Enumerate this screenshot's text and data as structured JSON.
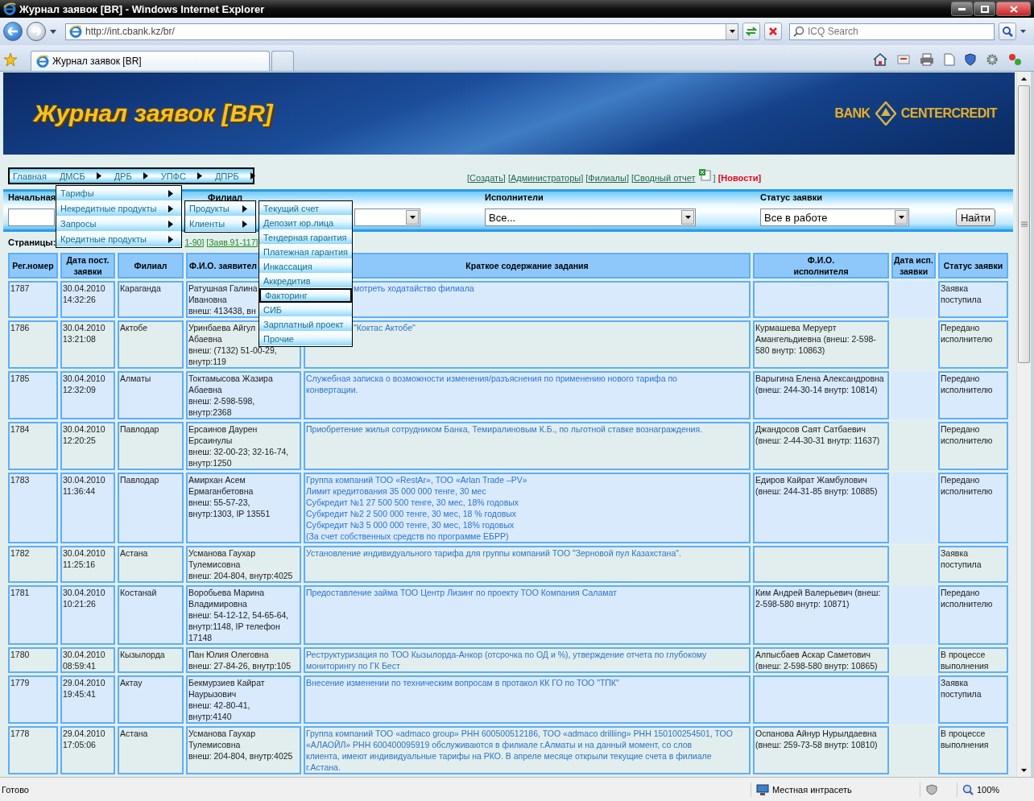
{
  "window": {
    "title": "Журнал заявок [BR] - Windows Internet Explorer"
  },
  "address_bar": {
    "url": "http://int.cbank.kz/br/"
  },
  "search": {
    "placeholder": "ICQ Search"
  },
  "tabs": [
    {
      "label": "Журнал заявок [BR]",
      "selected": true
    }
  ],
  "page": {
    "banner": {
      "title": "Журнал заявок [BR]",
      "logo_left": "BANK",
      "logo_right": "CENTERCREDIT"
    },
    "nav": [
      {
        "label": "Главная",
        "has_submenu": false
      },
      {
        "label": "ДМСБ",
        "has_submenu": true
      },
      {
        "label": "ДРБ",
        "has_submenu": true
      },
      {
        "label": "УПФС",
        "has_submenu": true
      },
      {
        "label": "ДПРБ",
        "has_submenu": true
      }
    ],
    "nav_menu": [
      {
        "label": "Тарифы",
        "has_submenu": true
      },
      {
        "label": "Некредитные продукты",
        "has_submenu": true
      },
      {
        "label": "Запросы",
        "has_submenu": true
      },
      {
        "label": "Кредитные продукты",
        "has_submenu": true
      }
    ],
    "submenu": [
      {
        "label": "Продукты",
        "has_submenu": true
      },
      {
        "label": "Клиенты",
        "has_submenu": true
      }
    ],
    "product_menu": [
      {
        "label": "Текущий счет",
        "selected": false
      },
      {
        "label": "Депозит юр.лица",
        "selected": false
      },
      {
        "label": "Тендерная гарантия",
        "selected": false
      },
      {
        "label": "Платежная гарантия",
        "selected": false
      },
      {
        "label": "Инкассация",
        "selected": false
      },
      {
        "label": "Аккредитив",
        "selected": false
      },
      {
        "label": "Факторинг",
        "selected": true
      },
      {
        "label": "СИБ",
        "selected": false
      },
      {
        "label": "Зарплатный проект",
        "selected": false
      },
      {
        "label": "Прочие",
        "selected": false
      }
    ],
    "links": [
      {
        "label": "[Создать]",
        "kind": "link"
      },
      {
        "label": "[Администраторы]",
        "kind": "link"
      },
      {
        "label": "[Филиалы]",
        "kind": "link"
      },
      {
        "label": "[Сводный отчет ",
        "kind": "report",
        "suffix": "]"
      },
      {
        "label": "[Новости]",
        "kind": "news"
      }
    ],
    "filters": {
      "start_label": "Начальная",
      "branch_label": "Филиал",
      "executors_label": "Исполнители",
      "executors_value": "Все...",
      "status_label": "Статус заявки",
      "status_value": "Все в работе",
      "find_button": "Найти"
    },
    "pages": {
      "label": "Страницы:",
      "links": [
        "1-90]",
        "[Заяв.91-117]"
      ]
    },
    "table": {
      "columns": [
        "Рег.номер",
        "Дата пост.\nзаявки",
        "Филиал",
        "Ф.И.О. заявител",
        "Краткое содержание задания",
        "Ф.И.О.\nисполнителя",
        "Дата исп.\nзаявки",
        "Статус заявки"
      ],
      "rows": [
        {
          "reg": "1787",
          "date": "30.04.2010\n14:32:26",
          "branch": "Караганда",
          "applicant": "Ратушная Галина\nИвановна\nвнеш: 413438, вн",
          "summary": "мотреть ходатайство филиала",
          "status": "Заявка\nпоступила"
        },
        {
          "reg": "1786",
          "date": "30.04.2010\n13:21:08",
          "branch": "Актобе",
          "applicant": "Уринбаева Айгул\nАбаевна\nвнеш: (7132) 51-00-29,\nвнутр:119",
          "summary": "\"Коктас Актобе\"",
          "executor": "Курмашева Меруерт\nАмангельдиевна (внеш: 2-598-\n580 внутр: 10863)",
          "status": "Передано\nисполнителю"
        },
        {
          "reg": "1785",
          "date": "30.04.2010\n12:32:09",
          "branch": "Алматы",
          "applicant": "Токтамысова Жазира\nАбаевна\nвнеш: 2-598-598,\nвнутр:2368",
          "summary": "Служебная записка о возможности изменения/разъяснения по применению нового тарифа по\nконвертации.",
          "executor": "Варыгина Елена Александровна\n(внеш: 244-30-14 внутр: 10814)",
          "status": "Передано\nисполнителю"
        },
        {
          "reg": "1784",
          "date": "30.04.2010\n12:20:25",
          "branch": "Павлодар",
          "applicant": "Ерсаинов Даурен\nЕрсаинулы\nвнеш: 32-00-23; 32-16-74,\nвнутр:1250",
          "summary": "Приобретение жилья сотрудником Банка, Темиралиновым К.Б., по льготной ставке вознаграждения.",
          "executor": "Джандосов Саят Сатбаевич\n(внеш: 2-44-30-31 внутр: 11637)",
          "status": "Передано\nисполнителю"
        },
        {
          "reg": "1783",
          "date": "30.04.2010\n11:36:44",
          "branch": "Павлодар",
          "applicant": "Амирхан Асем\nЕрмаганбетовна\nвнеш: 55-57-23,\nвнутр:1303, IP 13551",
          "summary": "Группа компаний ТОО «RestAr», ТОО «Arlan Trade –PV»\nЛимит кредитования 35 000 000 тенге, 30 мес\nСубкредит №1 27 500 500 тенге, 30 мес, 18% годовых\nСубкредит №2 2 500 000 тенге, 30 мес, 18 % годовых\nСубкредит №3 5 000 000 тенге, 30 мес, 18% годовых\n(За счет собственных средств по программе ЕБРР)",
          "executor": "Едиров Кайрат Жамбулович\n(внеш: 244-31-85 внутр: 10885)",
          "status": "Передано\nисполнителю"
        },
        {
          "reg": "1782",
          "date": "30.04.2010\n11:25:16",
          "branch": "Астана",
          "applicant": "Усманова Гаухар\nТулемисовна\nвнеш: 204-804, внутр:4025",
          "summary": "Установление индивидуального тарифа для группы компаний ТОО \"Зерновой пул Казахстана\".",
          "status": "Заявка\nпоступила"
        },
        {
          "reg": "1781",
          "date": "30.04.2010\n10:21:26",
          "branch": "Костанай",
          "applicant": "Воробьева Марина\nВладимировна\nвнеш: 54-12-12, 54-65-64,\nвнутр:1148, IP телефон\n17148",
          "summary": "Предоставление займа ТОО Центр Лизинг по проекту ТОО Компания Саламат",
          "executor": "Ким Андрей Валерьевич (внеш:\n2-598-580 внутр: 10871)",
          "status": "Передано\nисполнителю"
        },
        {
          "reg": "1780",
          "date": "30.04.2010\n08:59:41",
          "branch": "Кызылорда",
          "applicant": "Пан Юлия Олеговна\nвнеш: 27-84-26, внутр:105",
          "summary": "Реструктуризация по ТОО Кызылорда-Анкор (отсрочка по ОД и %), утверждение отчета по глубокому\nмониторингу по ГК Бест",
          "executor": "Алпысбаев Аскар Саметович\n(внеш: 2-598-580 внутр: 10865)",
          "status": "В процессе\nвыполнения"
        },
        {
          "reg": "1779",
          "date": "29.04.2010\n19:45:41",
          "branch": "Актау",
          "applicant": "Бекмурзиев Кайрат\nНаурызович\nвнеш: 42-80-41,\nвнутр:4140",
          "summary": "Внесение изменении по техническим вопросам в протакол КК ГО по ТОО \"ТПК\"",
          "status": "Заявка\nпоступила"
        },
        {
          "reg": "1778",
          "date": "29.04.2010\n17:05:06",
          "branch": "Астана",
          "applicant": "Усманова Гаухар\nТулемисовна\nвнеш: 204-804, внутр:4025",
          "summary": "Группа компаний ТОО «admaco group» РНН 600500512186, ТОО «admaco drilliing» РНН 150100254501, ТОО\n«АЛАОЙЛ» РНН 600400095919 обслуживаются в филиале г.Алматы и на данный момент, со слов\nклиента, имеют индивидуальные тарифы на РКО. В апреле месяце открыли текущие счета в филиале\nг.Астана.",
          "executor": "Оспанова Айнур Нурылдаевна\n(внеш: 259-73-58 внутр: 10810)",
          "status": "В процессе\nвыполнения"
        }
      ]
    }
  },
  "status_bar": {
    "text": "Готово",
    "zone": "Местная интрасеть",
    "zoom": "100%"
  }
}
